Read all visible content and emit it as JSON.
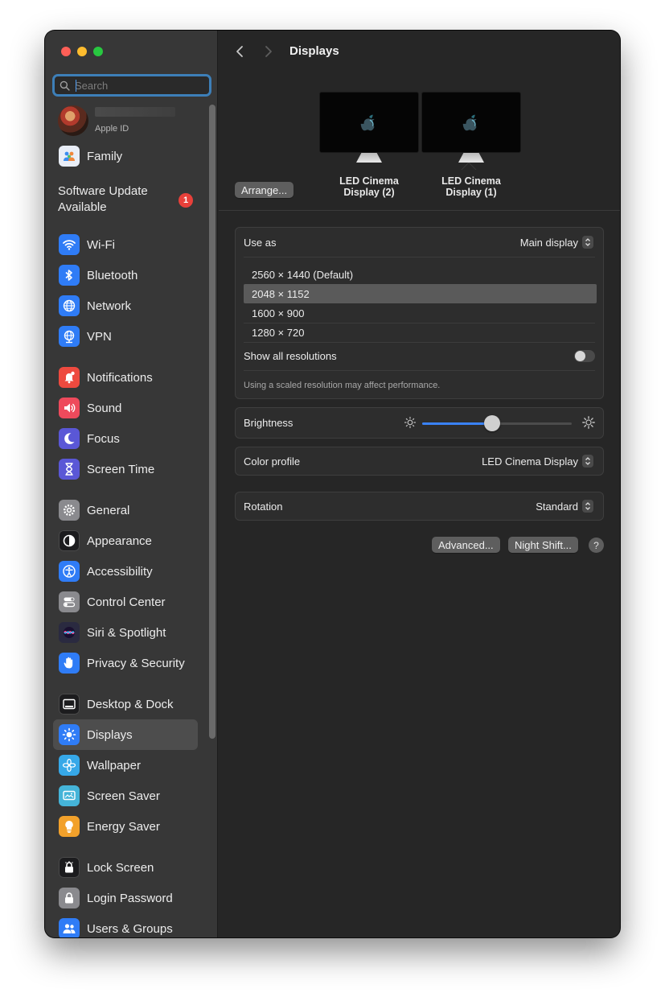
{
  "window": {
    "title": "Displays"
  },
  "search": {
    "placeholder": "Search"
  },
  "profile": {
    "subtitle": "Apple ID"
  },
  "family": {
    "label": "Family"
  },
  "software_update": {
    "label": "Software Update Available",
    "badge": "1"
  },
  "sidebar": {
    "items": [
      {
        "label": "Wi-Fi",
        "icon": "wifi-icon",
        "color": "#2f7cf6"
      },
      {
        "label": "Bluetooth",
        "icon": "bluetooth-icon",
        "color": "#2f7cf6"
      },
      {
        "label": "Network",
        "icon": "globe-icon",
        "color": "#2f7cf6"
      },
      {
        "label": "VPN",
        "icon": "vpn-globe-icon",
        "color": "#2f7cf6"
      },
      {
        "label": "Notifications",
        "icon": "bell-icon",
        "color": "#ee4a3f"
      },
      {
        "label": "Sound",
        "icon": "speaker-icon",
        "color": "#ee4a5c"
      },
      {
        "label": "Focus",
        "icon": "moon-icon",
        "color": "#5a57d6"
      },
      {
        "label": "Screen Time",
        "icon": "hourglass-icon",
        "color": "#5a57d6"
      },
      {
        "label": "General",
        "icon": "gear-icon",
        "color": "#8a8a8e"
      },
      {
        "label": "Appearance",
        "icon": "appearance-icon",
        "color": "#1c1c1e"
      },
      {
        "label": "Accessibility",
        "icon": "accessibility-icon",
        "color": "#2f7cf6"
      },
      {
        "label": "Control Center",
        "icon": "toggles-icon",
        "color": "#8a8a8e"
      },
      {
        "label": "Siri & Spotlight",
        "icon": "siri-icon",
        "color": "#2a2a40"
      },
      {
        "label": "Privacy & Security",
        "icon": "hand-icon",
        "color": "#2f7cf6"
      },
      {
        "label": "Desktop & Dock",
        "icon": "dock-icon",
        "color": "#1c1c1e"
      },
      {
        "label": "Displays",
        "icon": "sun-icon",
        "color": "#2f7cf6",
        "selected": true
      },
      {
        "label": "Wallpaper",
        "icon": "flower-icon",
        "color": "#36a8e8"
      },
      {
        "label": "Screen Saver",
        "icon": "screensaver-icon",
        "color": "#45b4d8"
      },
      {
        "label": "Energy Saver",
        "icon": "lightbulb-icon",
        "color": "#f2a12b"
      },
      {
        "label": "Lock Screen",
        "icon": "lock-icon",
        "color": "#1c1c1e"
      },
      {
        "label": "Login Password",
        "icon": "padlock-icon",
        "color": "#8a8a8e"
      },
      {
        "label": "Users & Groups",
        "icon": "users-icon",
        "color": "#2f7cf6"
      }
    ]
  },
  "displays": [
    {
      "label": "LED Cinema Display (2)",
      "name": "LED Cinema",
      "suffix": "Display (2)"
    },
    {
      "label": "LED Cinema Display (1)",
      "name": "LED Cinema",
      "suffix": "Display (1)"
    }
  ],
  "arrange_button": "Arrange...",
  "use_as": {
    "label": "Use as",
    "value": "Main display"
  },
  "resolutions": [
    "2560 × 1440 (Default)",
    "2048 × 1152",
    "1600 × 900",
    "1280 × 720"
  ],
  "selected_resolution": "2048 × 1152",
  "show_all": {
    "label": "Show all resolutions",
    "enabled": false
  },
  "scaled_note": "Using a scaled resolution may affect performance.",
  "brightness": {
    "label": "Brightness",
    "level": 0.47
  },
  "color_profile": {
    "label": "Color profile",
    "value": "LED Cinema Display"
  },
  "rotation": {
    "label": "Rotation",
    "value": "Standard"
  },
  "buttons": {
    "advanced": "Advanced...",
    "night_shift": "Night Shift...",
    "help": "?"
  }
}
